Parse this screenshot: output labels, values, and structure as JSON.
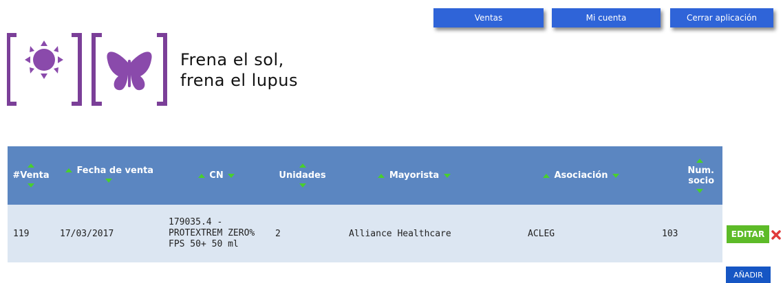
{
  "nav": {
    "sales_label": "Ventas",
    "account_label": "Mi cuenta",
    "logout_label": "Cerrar aplicación"
  },
  "brand": {
    "tagline_line1": "Frena el sol,",
    "tagline_line2": "frena el lupus",
    "colors": {
      "bracket": "#7b3f98",
      "sun": "#8a4aab",
      "butterfly": "#8a4aab"
    }
  },
  "table": {
    "headers": {
      "venta": "#Venta",
      "fecha": "Fecha de venta",
      "cn": "CN",
      "unidades": "Unidades",
      "mayorista": "Mayorista",
      "asociacion": "Asociación",
      "num_socio_1": "Num.",
      "num_socio_2": "socio"
    },
    "rows": [
      {
        "venta": "119",
        "fecha": "17/03/2017",
        "cn": "179035.4 - PROTEXTREM ZERO% FPS 50+ 50 ml",
        "unidades": "2",
        "mayorista": "Alliance Healthcare",
        "asociacion": "ACLEG",
        "num_socio": "103"
      }
    ]
  },
  "actions": {
    "edit_label": "EDITAR",
    "add_label": "AÑADIR"
  },
  "icons": {
    "sort": "sort-arrow-icon",
    "delete": "delete-x-icon"
  },
  "colors": {
    "header_bg": "#5b86c1",
    "row_bg": "#dce6f2",
    "nav_bg": "#2f64d8",
    "edit_bg": "#5dbb28",
    "delete": "#e03a3a",
    "sort_arrow": "#49d02c"
  }
}
